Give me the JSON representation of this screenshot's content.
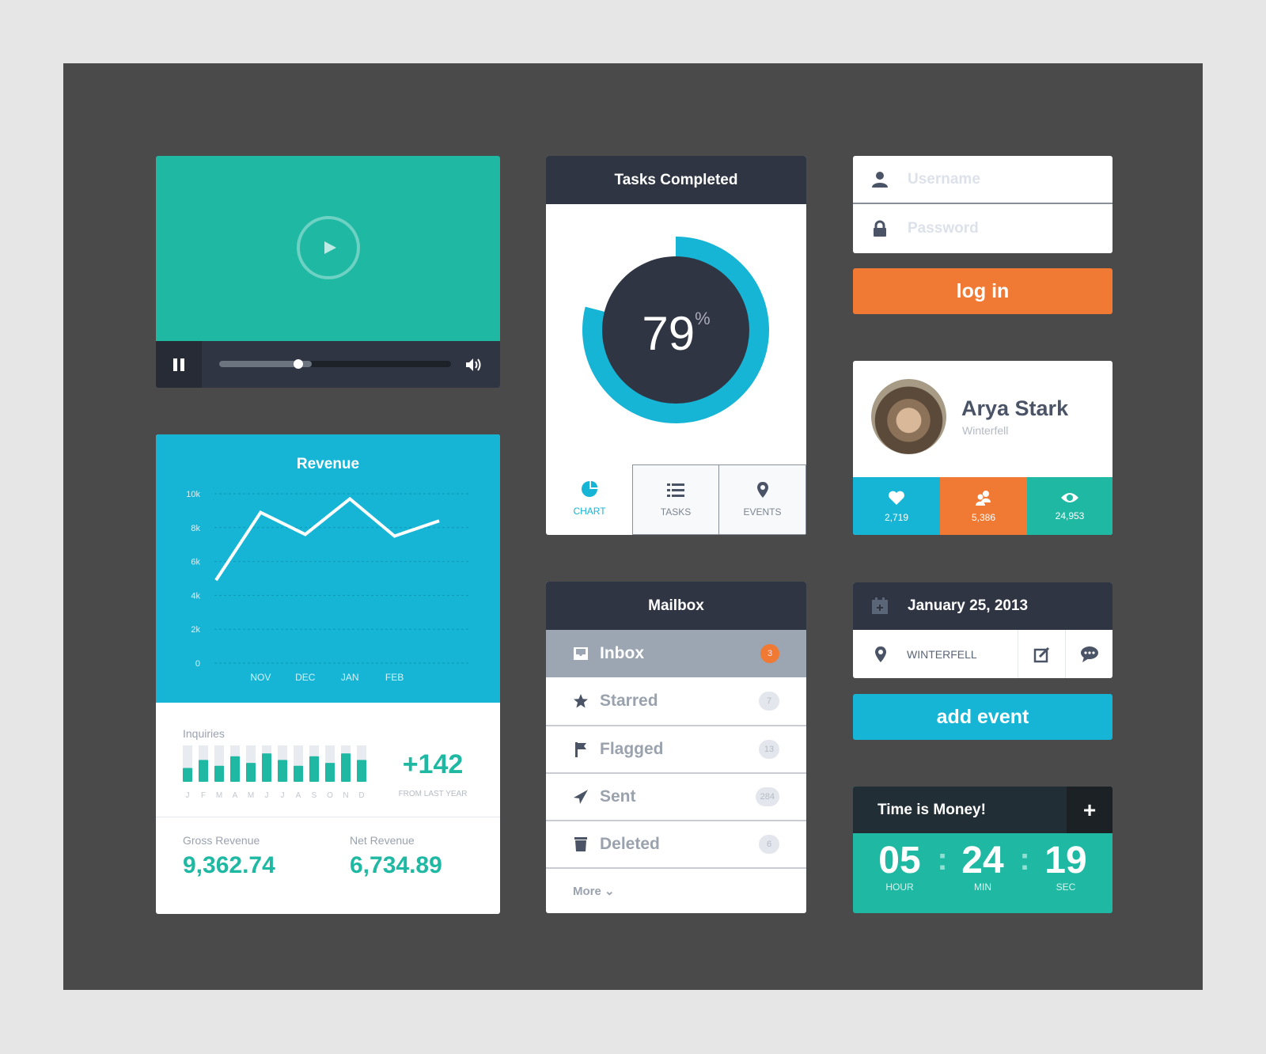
{
  "colors": {
    "teal": "#1fb9a3",
    "blue": "#16b5d6",
    "orange": "#f07a33",
    "dark": "#2f3542"
  },
  "video": {
    "progress": 0.34,
    "play_icon": "play-icon",
    "pause_icon": "pause-icon",
    "volume_icon": "volume-icon"
  },
  "revenue": {
    "chart_data": {
      "type": "line",
      "title": "Revenue",
      "categories": [
        "",
        "NOV",
        "DEC",
        "JAN",
        "FEB",
        ""
      ],
      "values": [
        4900,
        8900,
        7600,
        9700,
        7500,
        8400
      ],
      "yticks": [
        "10k",
        "8k",
        "6k",
        "4k",
        "2k",
        "0"
      ],
      "ylim": [
        0,
        10000
      ],
      "grid": true
    },
    "inquiries": {
      "label": "Inquiries",
      "chart_data": {
        "type": "bar",
        "categories": [
          "J",
          "F",
          "M",
          "A",
          "M",
          "J",
          "J",
          "A",
          "S",
          "O",
          "N",
          "D"
        ],
        "values": [
          0.38,
          0.6,
          0.44,
          0.7,
          0.52,
          0.78,
          0.6,
          0.44,
          0.7,
          0.52,
          0.78,
          0.6
        ]
      },
      "delta": "+142",
      "delta_caption": "FROM LAST YEAR"
    },
    "gross_label": "Gross Revenue",
    "gross_value": "9,362.74",
    "net_label": "Net Revenue",
    "net_value": "6,734.89"
  },
  "tasks": {
    "title": "Tasks Completed",
    "percent": 79,
    "percent_text": "79",
    "percent_sign": "%",
    "tabs": [
      {
        "label": "CHART",
        "icon": "pie-chart-icon"
      },
      {
        "label": "TASKS",
        "icon": "list-icon"
      },
      {
        "label": "EVENTS",
        "icon": "map-pin-icon"
      }
    ]
  },
  "mailbox": {
    "title": "Mailbox",
    "items": [
      {
        "label": "Inbox",
        "count": "3",
        "icon": "inbox-icon"
      },
      {
        "label": "Starred",
        "count": "7",
        "icon": "star-icon"
      },
      {
        "label": "Flagged",
        "count": "13",
        "icon": "flag-icon"
      },
      {
        "label": "Sent",
        "count": "284",
        "icon": "send-icon"
      },
      {
        "label": "Deleted",
        "count": "6",
        "icon": "trash-icon"
      }
    ],
    "more": "More ⌄"
  },
  "login": {
    "username_placeholder": "Username",
    "password_placeholder": "Password",
    "button": "log in"
  },
  "profile": {
    "name": "Arya Stark",
    "location": "Winterfell",
    "likes": "2,719",
    "followers": "5,386",
    "views": "24,953"
  },
  "event": {
    "date": "January 25, 2013",
    "location": "WINTERFELL",
    "button": "add event"
  },
  "timer": {
    "title": "Time is Money!",
    "add": "+",
    "hour": "05",
    "min": "24",
    "sec": "19",
    "hour_label": "HOUR",
    "min_label": "MIN",
    "sec_label": "SEC",
    "sep": ":"
  }
}
